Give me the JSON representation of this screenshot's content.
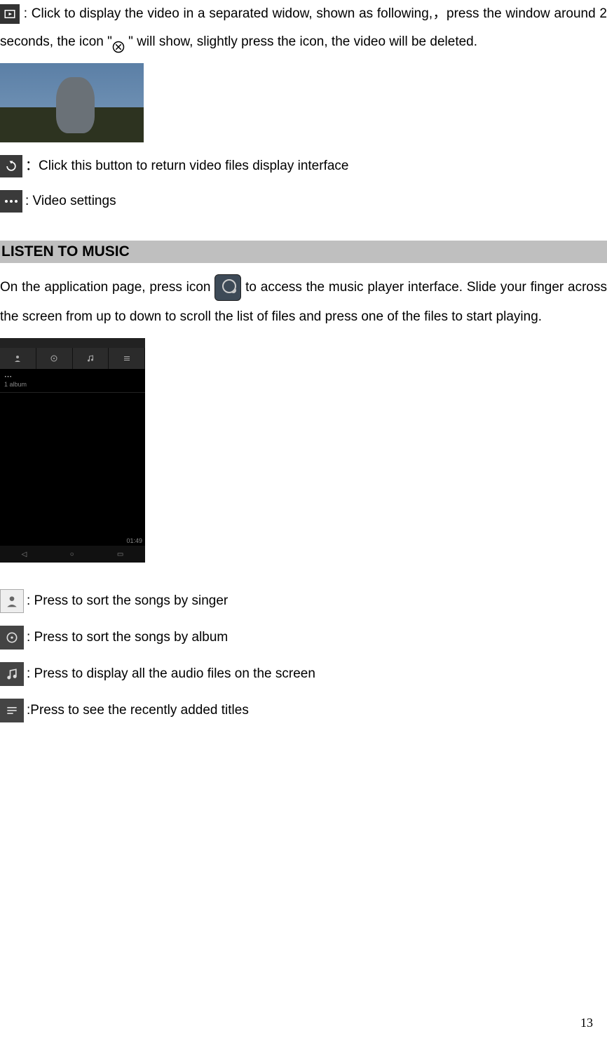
{
  "video_section": {
    "line1_part1": " : Click to display the video in a separated widow, shown as following,，press the window around 2 seconds, the icon \"",
    "line1_part2": "  \" will show, slightly press the icon, the video will be deleted.",
    "return_text": "：Click this button to return video files display interface",
    "settings_text": ": Video settings"
  },
  "music_section": {
    "header": "LISTEN TO MUSIC",
    "intro_part1": "On the application page, press icon ",
    "intro_part2": " to access the music player interface. Slide your finger across the screen from up to down to scroll the list of files and press one of the files to start playing.",
    "screenshot": {
      "row_label": "1 album",
      "time": "01:49"
    },
    "rows": [
      ": Press to sort the songs by singer",
      ": Press to sort the songs by album",
      ": Press to display all the audio files on the screen",
      ":Press to see the recently added titles"
    ]
  },
  "page_number": "13"
}
